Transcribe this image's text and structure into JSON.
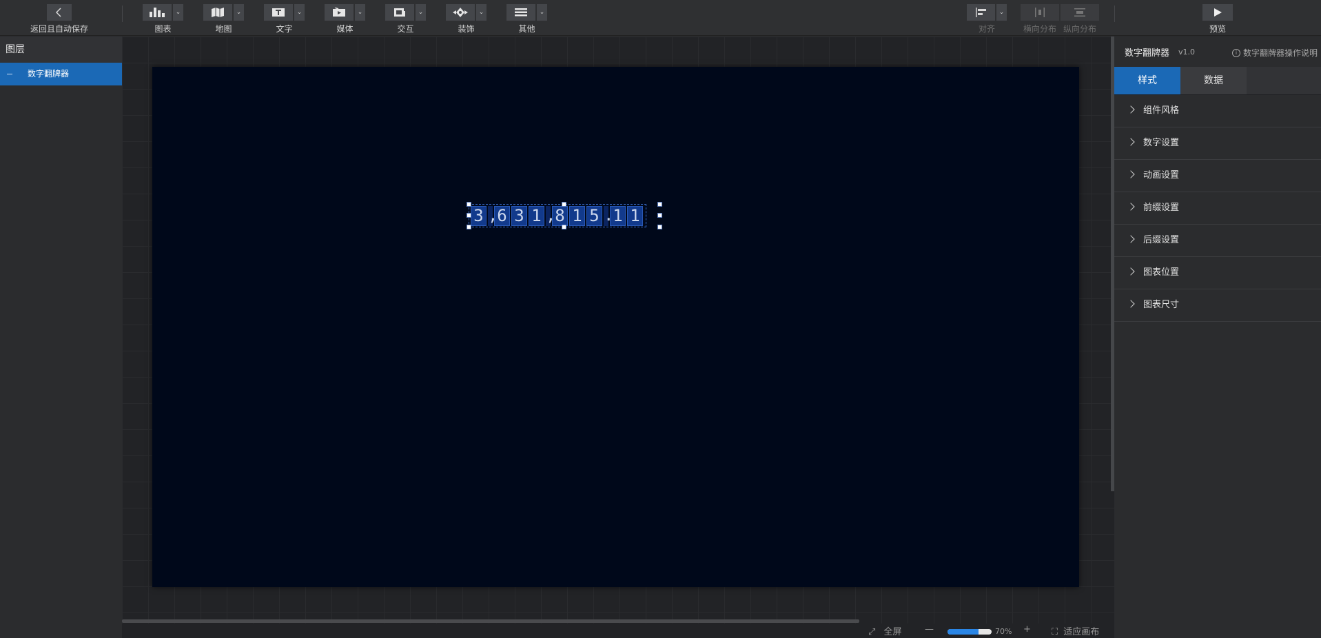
{
  "toolbar": {
    "back_label": "返回且自动保存",
    "tools": [
      {
        "label": "图表",
        "icon": "bar-chart-icon"
      },
      {
        "label": "地图",
        "icon": "map-icon"
      },
      {
        "label": "文字",
        "icon": "text-icon"
      },
      {
        "label": "媒体",
        "icon": "media-icon"
      },
      {
        "label": "交互",
        "icon": "interaction-icon"
      },
      {
        "label": "装饰",
        "icon": "decoration-icon"
      },
      {
        "label": "其他",
        "icon": "other-icon"
      }
    ],
    "align_label": "对齐",
    "hdist_label": "横向分布",
    "vdist_label": "纵向分布",
    "preview_label": "预览"
  },
  "layers": {
    "title": "图层",
    "items": [
      {
        "label": "数字翻牌器"
      }
    ]
  },
  "canvas": {
    "flipper_chars": [
      "3",
      ",",
      "6",
      "3",
      "1",
      ",",
      "8",
      "1",
      "5",
      ".",
      "1",
      "1"
    ],
    "background": "#00081a",
    "digit_bg": "#123a8c"
  },
  "bottom": {
    "fullscreen_label": "全屏",
    "zoom_minus": "—",
    "zoom_value": "70%",
    "zoom_fraction": 0.7,
    "zoom_plus": "+",
    "fit_label": "适应画布"
  },
  "right_panel": {
    "title": "数字翻牌器",
    "version": "v1.0",
    "help_label": "数字翻牌器操作说明",
    "tabs": [
      {
        "label": "样式",
        "active": true
      },
      {
        "label": "数据",
        "active": false
      }
    ],
    "sections": [
      "组件风格",
      "数字设置",
      "动画设置",
      "前缀设置",
      "后缀设置",
      "图表位置",
      "图表尺寸"
    ]
  },
  "colors": {
    "accent": "#1b69b6",
    "panel": "#2b2c2e"
  }
}
